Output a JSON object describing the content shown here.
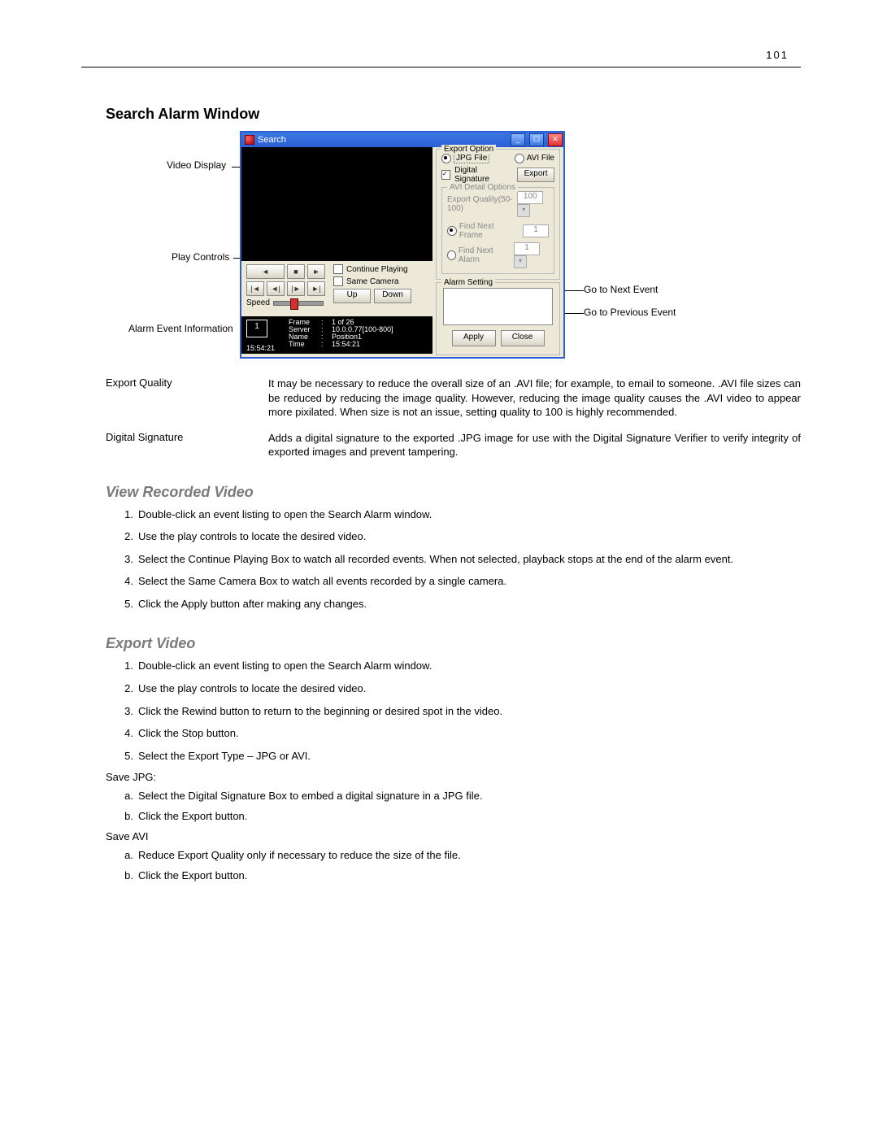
{
  "page_number": "101",
  "main_heading": "Search Alarm Window",
  "callouts": {
    "video_display": "Video Display",
    "play_controls": "Play Controls",
    "alarm_event_info": "Alarm Event Information",
    "go_next": "Go to Next Event",
    "go_prev": "Go to Previous Event"
  },
  "window": {
    "title": "Search",
    "export_option_title": "Export Option",
    "jpg_radio": "JPG File",
    "avi_radio": "AVI File",
    "digital_signature": "Digital Signature",
    "export_btn": "Export",
    "avi_detail_title": "AVI Detail Options",
    "export_quality_label": "Export Quality(50-100)",
    "export_quality_value": "100",
    "find_next_frame": "Find Next Frame",
    "find_next_alarm": "Find Next Alarm",
    "find_next_frame_value": "1",
    "find_next_alarm_value": "1",
    "alarm_setting_title": "Alarm Setting",
    "apply_btn": "Apply",
    "close_btn": "Close",
    "continue_playing": "Continue Playing",
    "same_camera": "Same Camera",
    "up_btn": "Up",
    "down_btn": "Down",
    "speed_label": "Speed",
    "info_num": "1",
    "info_time_corner": "15:54:21",
    "info_frame_label": "Frame",
    "info_frame_value": "1 of 26",
    "info_server_label": "Server",
    "info_server_value": "10.0.0.77[100-800]",
    "info_name_label": "Name",
    "info_name_value": "Position1",
    "info_time_label": "Time",
    "info_time_value": "15:54:21",
    "pb_rewind": "◄",
    "pb_stop": "■",
    "pb_play": "►",
    "pb_first": "|◄",
    "pb_stepback": "◄|",
    "pb_stepfwd": "|►",
    "pb_last": "►|"
  },
  "desc_rows": [
    {
      "label": "Export Quality",
      "text": "It may be necessary to reduce the overall size of an .AVI file; for example, to email to someone. .AVI file sizes can be reduced by reducing the image quality.  However, reducing the image quality causes the .AVI video to appear more pixilated.  When size is not an issue, setting quality to 100 is highly recommended."
    },
    {
      "label": "Digital Signature",
      "text": "Adds a digital signature to the exported .JPG image for use with the Digital Signature Verifier to verify integrity of exported images and prevent tampering."
    }
  ],
  "view_heading": "View Recorded Video",
  "view_steps": [
    "Double-click an event listing to open the Search Alarm window.",
    "Use the play controls to locate the desired video.",
    "Select the Continue Playing Box to watch all recorded events.  When not selected, playback stops at the end of the alarm event.",
    "Select the Same Camera Box to watch all events recorded by a single camera.",
    "Click the Apply button after making any changes."
  ],
  "export_heading": "Export Video",
  "export_steps": [
    "Double-click an event listing to open the Search Alarm window.",
    "Use the play controls to locate the desired video.",
    "Click the Rewind button to return to the beginning or desired spot in the video.",
    "Click the Stop button.",
    "Select the Export Type – JPG or AVI."
  ],
  "save_jpg_label": "Save JPG:",
  "save_jpg_steps": [
    "Select the Digital Signature Box to embed a digital signature in a JPG file.",
    "Click the Export button."
  ],
  "save_avi_label": "Save AVI",
  "save_avi_steps": [
    "Reduce Export Quality only if necessary to reduce the size of the file.",
    "Click the Export button."
  ]
}
